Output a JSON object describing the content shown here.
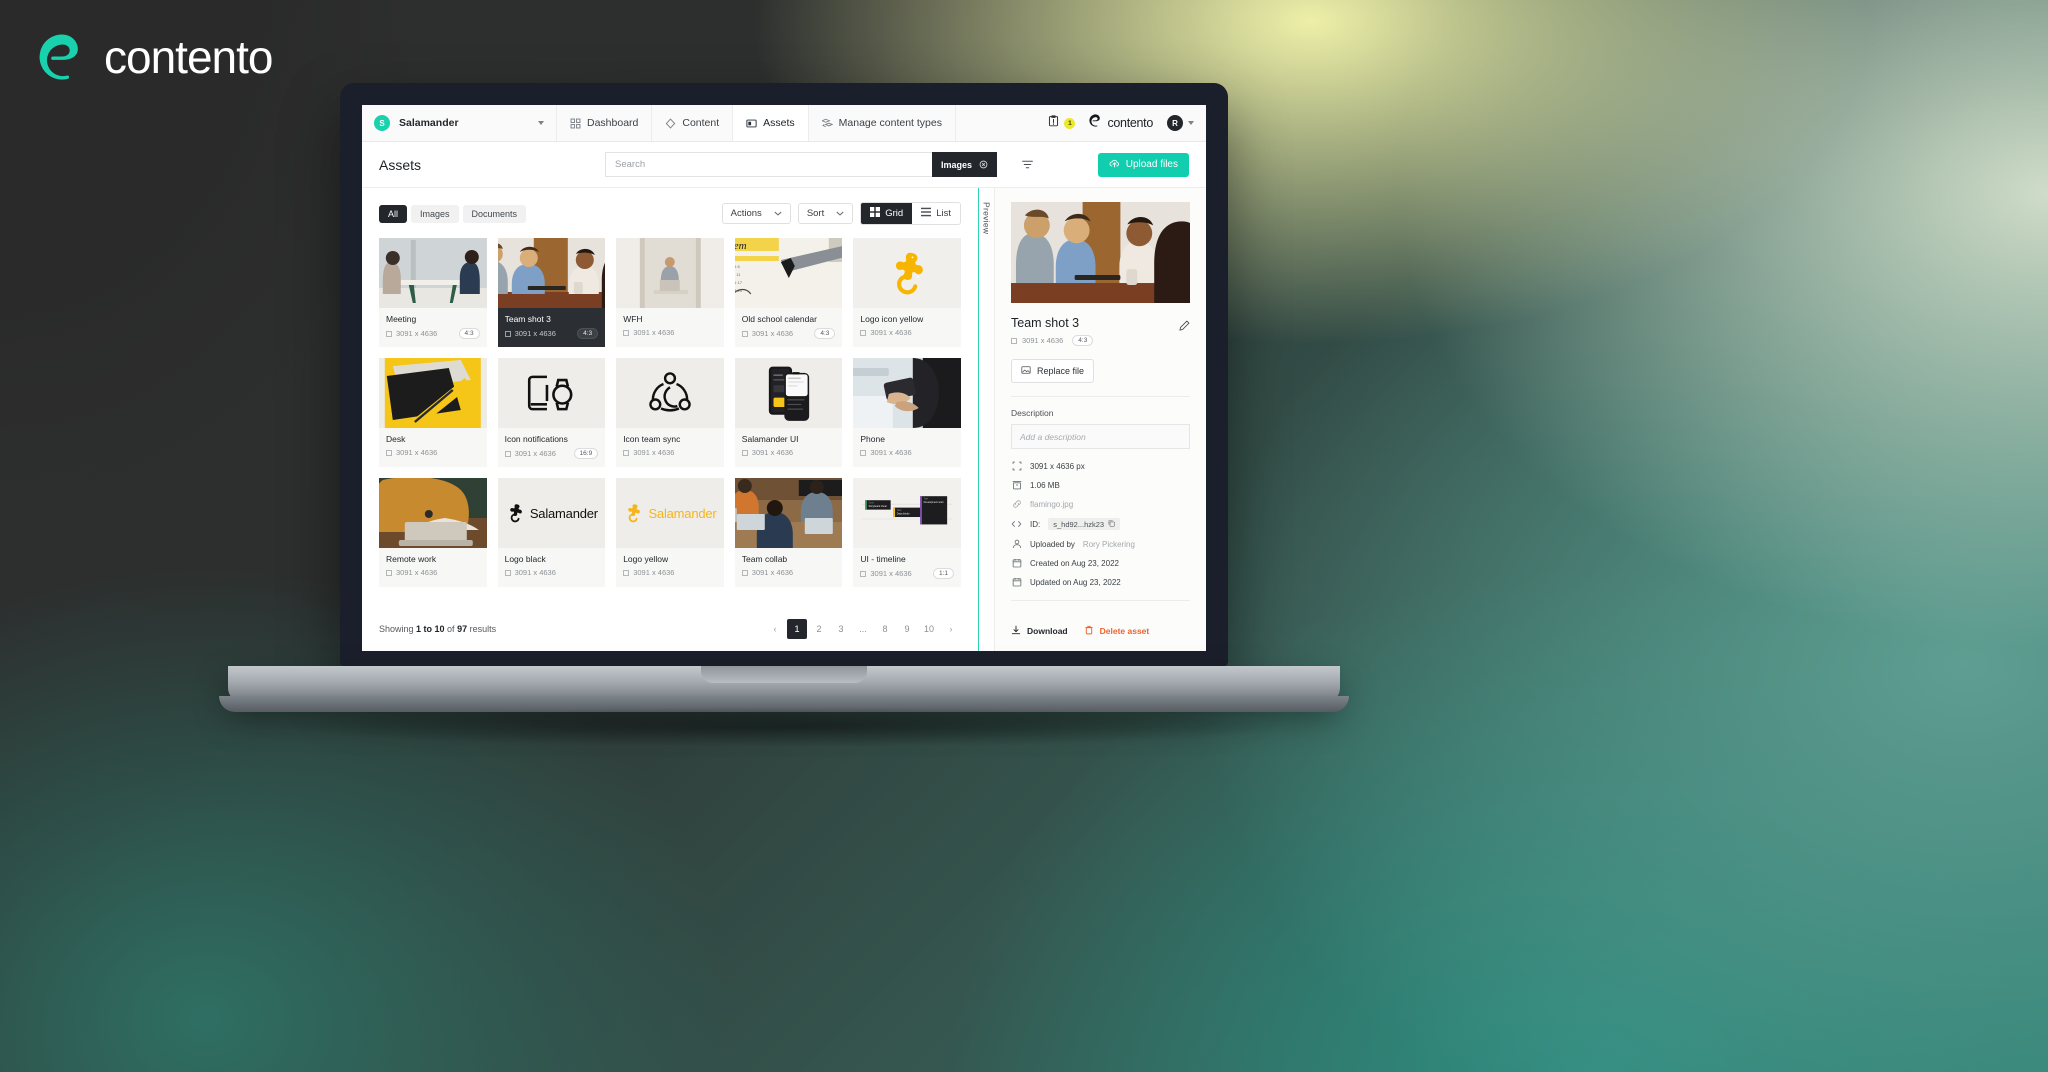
{
  "brand": {
    "name": "contento",
    "accent": "#11cfae"
  },
  "device": {
    "label": "Macbook Pro"
  },
  "topnav": {
    "site": {
      "initial": "S",
      "name": "Salamander"
    },
    "tabs": [
      {
        "label": "Dashboard",
        "icon": "dashboard-icon",
        "active": false
      },
      {
        "label": "Content",
        "icon": "content-icon",
        "active": false
      },
      {
        "label": "Assets",
        "icon": "assets-icon",
        "active": true
      },
      {
        "label": "Manage content types",
        "icon": "layers-icon",
        "active": false
      }
    ],
    "notifications_count": "1",
    "product_name": "contento",
    "user_initial": "R"
  },
  "header": {
    "title": "Assets",
    "search_placeholder": "Search",
    "search_value": "",
    "active_filter_chip": "Images",
    "upload_label": "Upload files"
  },
  "toolbar": {
    "type_filters": [
      {
        "label": "All",
        "active": true
      },
      {
        "label": "Images",
        "active": false
      },
      {
        "label": "Documents",
        "active": false
      }
    ],
    "actions_label": "Actions",
    "sort_label": "Sort",
    "views": [
      {
        "label": "Grid",
        "active": true
      },
      {
        "label": "List",
        "active": false
      }
    ]
  },
  "assets": [
    {
      "title": "Meeting",
      "dims": "3091 x 4636",
      "ratio": "4:3",
      "selected": false,
      "thumb": "photo-meeting"
    },
    {
      "title": "Team shot 3",
      "dims": "3091 x 4636",
      "ratio": "4:3",
      "selected": true,
      "thumb": "photo-team3"
    },
    {
      "title": "WFH",
      "dims": "3091 x 4636",
      "ratio": "",
      "selected": false,
      "thumb": "photo-wfh"
    },
    {
      "title": "Old school calendar",
      "dims": "3091 x 4636",
      "ratio": "4:3",
      "selected": false,
      "thumb": "photo-calendar"
    },
    {
      "title": "Logo icon yellow",
      "dims": "3091 x 4636",
      "ratio": "",
      "selected": false,
      "thumb": "logo-icon-yellow"
    },
    {
      "title": "Desk",
      "dims": "3091 x 4636",
      "ratio": "",
      "selected": false,
      "thumb": "photo-desk"
    },
    {
      "title": "Icon notifications",
      "dims": "3091 x 4636",
      "ratio": "16:9",
      "selected": false,
      "thumb": "icon-notifications"
    },
    {
      "title": "Icon team sync",
      "dims": "3091 x 4636",
      "ratio": "",
      "selected": false,
      "thumb": "icon-team-sync"
    },
    {
      "title": "Salamander UI",
      "dims": "3091 x 4636",
      "ratio": "",
      "selected": false,
      "thumb": "photo-salamander-ui"
    },
    {
      "title": "Phone",
      "dims": "3091 x 4636",
      "ratio": "",
      "selected": false,
      "thumb": "photo-phone"
    },
    {
      "title": "Remote work",
      "dims": "3091 x 4636",
      "ratio": "",
      "selected": false,
      "thumb": "photo-remote-work"
    },
    {
      "title": "Logo black",
      "dims": "3091 x 4636",
      "ratio": "",
      "selected": false,
      "thumb": "logo-black"
    },
    {
      "title": "Logo yellow",
      "dims": "3091 x 4636",
      "ratio": "",
      "selected": false,
      "thumb": "logo-yellow"
    },
    {
      "title": "Team collab",
      "dims": "3091 x 4636",
      "ratio": "",
      "selected": false,
      "thumb": "photo-team-collab"
    },
    {
      "title": "UI - timeline",
      "dims": "3091 x 4636",
      "ratio": "1:1",
      "selected": false,
      "thumb": "ui-timeline"
    }
  ],
  "footer": {
    "showing_prefix": "Showing ",
    "showing_range": "1 to 10",
    "showing_mid": " of ",
    "showing_total": "97",
    "showing_suffix": " results",
    "pages": [
      "1",
      "2",
      "3",
      "...",
      "8",
      "9",
      "10"
    ],
    "current_page": "1"
  },
  "preview": {
    "tab_label": "Preview",
    "title": "Team shot 3",
    "dims": "3091 x 4636",
    "ratio": "4:3",
    "replace_label": "Replace file",
    "description_label": "Description",
    "description_placeholder": "Add a description",
    "description_value": "",
    "meta": [
      {
        "icon": "dimensions-icon",
        "label": "3091 x 4636 px",
        "muted": ""
      },
      {
        "icon": "filesize-icon",
        "label": "1.06 MB",
        "muted": ""
      },
      {
        "icon": "link-icon",
        "label": "",
        "muted": "flamingo.jpg"
      },
      {
        "icon": "code-icon",
        "label": "ID:",
        "muted": "",
        "chip": "s_hd92...hzk23"
      },
      {
        "icon": "user-icon",
        "label": "Uploaded by",
        "muted": "Rory Pickering"
      },
      {
        "icon": "calendar-icon",
        "label": "Created on Aug 23, 2022",
        "muted": ""
      },
      {
        "icon": "calendar-icon",
        "label": "Updated on Aug 23, 2022",
        "muted": ""
      }
    ],
    "download_label": "Download",
    "delete_label": "Delete asset",
    "delete_color": "#f0622d"
  }
}
